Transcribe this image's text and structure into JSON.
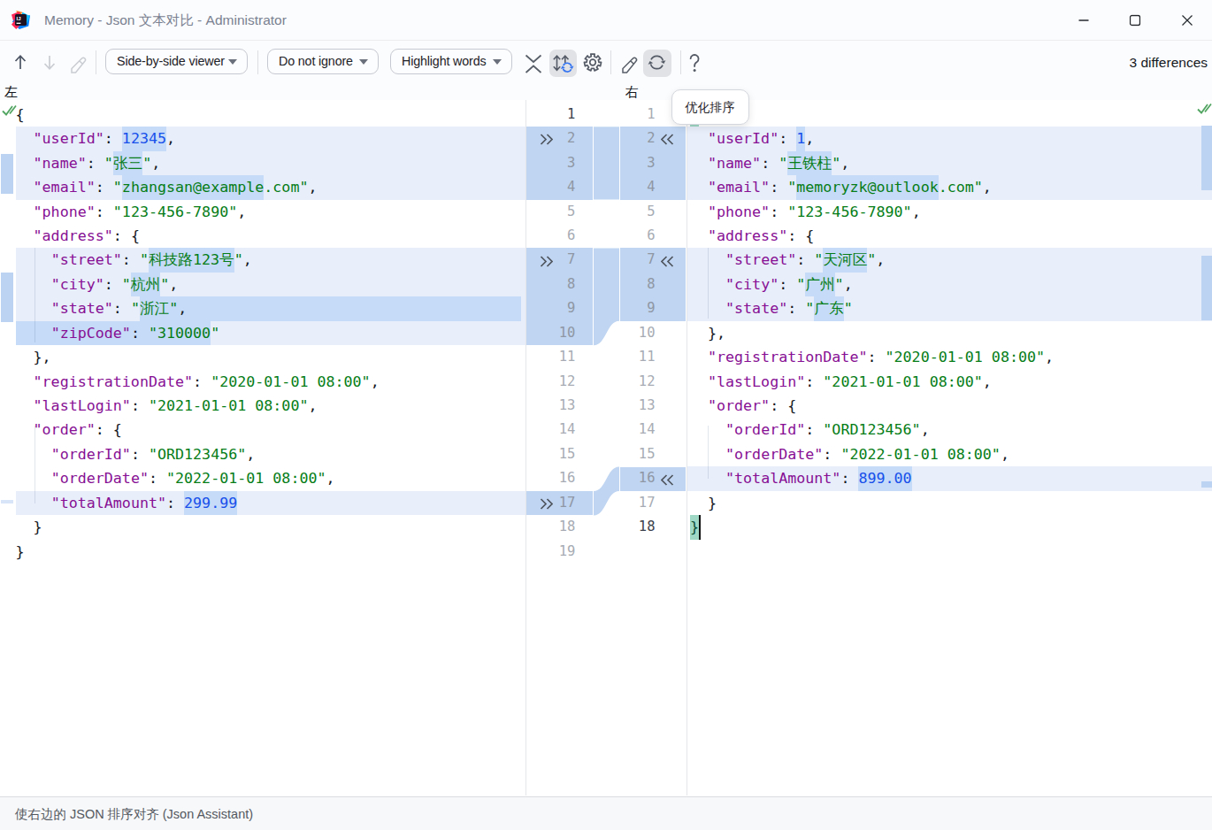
{
  "window": {
    "title": "Memory - Json 文本对比 - Administrator",
    "app_icon": "intellij-idea-logo"
  },
  "toolbar": {
    "viewer_dropdown": "Side-by-side viewer",
    "ignore_dropdown": "Do not ignore",
    "highlight_dropdown": "Highlight words",
    "differences_label": "3 differences",
    "icons": [
      "previous-difference",
      "next-difference",
      "edit",
      "collapse",
      "sort-align",
      "settings",
      "edit-source",
      "optimize-sort-refresh",
      "help"
    ]
  },
  "pane_headers": {
    "left": "左",
    "right": "右"
  },
  "tooltip": {
    "text": "优化排序"
  },
  "status_bar": {
    "text": "使右边的 JSON 排序对齐 (Json Assistant)"
  },
  "colors": {
    "changed_line_bg": "#e8effb",
    "word_diff_bg": "#c6dbf7",
    "gutter_block_bg": "#bfd5f1",
    "stripe_mark": "#bcd4f1",
    "key": "#871094",
    "string": "#067d17",
    "number": "#1750eb",
    "punctuation": "#15181e",
    "matched_brace_bg": "#9fd8c5",
    "accent_blue": "#3574f0",
    "icon_gray": "#5a616e",
    "check_green": "#51a561"
  },
  "diff_blocks": [
    {
      "left": [
        2,
        4
      ],
      "right": [
        2,
        4
      ]
    },
    {
      "left": [
        7,
        10
      ],
      "right": [
        7,
        9
      ]
    },
    {
      "left": [
        17,
        17
      ],
      "right": [
        16,
        16
      ]
    }
  ],
  "left_editor": {
    "line_count": 19,
    "line_numbers": [
      1,
      2,
      3,
      4,
      5,
      6,
      7,
      8,
      9,
      10,
      11,
      12,
      13,
      14,
      15,
      16,
      17,
      18,
      19
    ],
    "changed_lines": [
      2,
      3,
      4,
      7,
      8,
      9,
      10,
      17
    ],
    "current_line": 1,
    "lines": [
      {
        "n": 1,
        "segs": [
          [
            "p",
            "{"
          ]
        ]
      },
      {
        "n": 2,
        "segs": [
          [
            "p",
            "  "
          ],
          [
            "k",
            "\"userId\""
          ],
          [
            "p",
            ": "
          ],
          [
            "n",
            "12345",
            1
          ],
          [
            "p",
            ","
          ]
        ]
      },
      {
        "n": 3,
        "segs": [
          [
            "p",
            "  "
          ],
          [
            "k",
            "\"name\""
          ],
          [
            "p",
            ": "
          ],
          [
            "s",
            "\""
          ],
          [
            "s",
            "张三",
            1
          ],
          [
            "s",
            "\""
          ],
          [
            "p",
            ","
          ]
        ]
      },
      {
        "n": 4,
        "segs": [
          [
            "p",
            "  "
          ],
          [
            "k",
            "\"email\""
          ],
          [
            "p",
            ": "
          ],
          [
            "s",
            "\""
          ],
          [
            "s",
            "zhangsan@example",
            1
          ],
          [
            "s",
            ".com\""
          ],
          [
            "p",
            ","
          ]
        ]
      },
      {
        "n": 5,
        "segs": [
          [
            "p",
            "  "
          ],
          [
            "k",
            "\"phone\""
          ],
          [
            "p",
            ": "
          ],
          [
            "s",
            "\"123-456-7890\""
          ],
          [
            "p",
            ","
          ]
        ]
      },
      {
        "n": 6,
        "segs": [
          [
            "p",
            "  "
          ],
          [
            "k",
            "\"address\""
          ],
          [
            "p",
            ": "
          ],
          [
            "p",
            "{"
          ]
        ]
      },
      {
        "n": 7,
        "segs": [
          [
            "p",
            "    "
          ],
          [
            "k",
            "\"street\""
          ],
          [
            "p",
            ": "
          ],
          [
            "s",
            "\""
          ],
          [
            "s",
            "科技路123号",
            1
          ],
          [
            "s",
            "\""
          ],
          [
            "p",
            ","
          ]
        ]
      },
      {
        "n": 8,
        "segs": [
          [
            "p",
            "    "
          ],
          [
            "k",
            "\"city\""
          ],
          [
            "p",
            ": "
          ],
          [
            "s",
            "\""
          ],
          [
            "s",
            "杭州",
            1
          ],
          [
            "s",
            "\""
          ],
          [
            "p",
            ","
          ]
        ]
      },
      {
        "n": 9,
        "tail": 1,
        "segs": [
          [
            "p",
            "    "
          ],
          [
            "k",
            "\"state\""
          ],
          [
            "p",
            ": "
          ],
          [
            "s",
            "\""
          ],
          [
            "s",
            "浙江",
            1
          ],
          [
            "s",
            "\"",
            1
          ],
          [
            "p",
            ",",
            1
          ]
        ]
      },
      {
        "n": 10,
        "segs": [
          [
            "p",
            "    ",
            1
          ],
          [
            "k",
            "\"zipCode\"",
            1
          ],
          [
            "p",
            ": ",
            1
          ],
          [
            "s",
            "\"310000",
            1
          ],
          [
            "s",
            "\""
          ]
        ]
      },
      {
        "n": 11,
        "segs": [
          [
            "p",
            "  },"
          ]
        ]
      },
      {
        "n": 12,
        "segs": [
          [
            "p",
            "  "
          ],
          [
            "k",
            "\"registrationDate\""
          ],
          [
            "p",
            ": "
          ],
          [
            "s",
            "\"2020-01-01 08:00\""
          ],
          [
            "p",
            ","
          ]
        ]
      },
      {
        "n": 13,
        "segs": [
          [
            "p",
            "  "
          ],
          [
            "k",
            "\"lastLogin\""
          ],
          [
            "p",
            ": "
          ],
          [
            "s",
            "\"2021-01-01 08:00\""
          ],
          [
            "p",
            ","
          ]
        ]
      },
      {
        "n": 14,
        "segs": [
          [
            "p",
            "  "
          ],
          [
            "k",
            "\"order\""
          ],
          [
            "p",
            ": "
          ],
          [
            "p",
            "{"
          ]
        ]
      },
      {
        "n": 15,
        "segs": [
          [
            "p",
            "    "
          ],
          [
            "k",
            "\"orderId\""
          ],
          [
            "p",
            ": "
          ],
          [
            "s",
            "\"ORD123456\""
          ],
          [
            "p",
            ","
          ]
        ]
      },
      {
        "n": 16,
        "segs": [
          [
            "p",
            "    "
          ],
          [
            "k",
            "\"orderDate\""
          ],
          [
            "p",
            ": "
          ],
          [
            "s",
            "\"2022-01-01 08:00\""
          ],
          [
            "p",
            ","
          ]
        ]
      },
      {
        "n": 17,
        "segs": [
          [
            "p",
            "    "
          ],
          [
            "k",
            "\"totalAmount\""
          ],
          [
            "p",
            ": "
          ],
          [
            "n",
            "299.99",
            1
          ]
        ]
      },
      {
        "n": 18,
        "segs": [
          [
            "p",
            "  }"
          ]
        ]
      },
      {
        "n": 19,
        "segs": [
          [
            "p",
            "}"
          ]
        ]
      }
    ]
  },
  "right_editor": {
    "line_count": 18,
    "line_numbers": [
      1,
      2,
      3,
      4,
      5,
      6,
      7,
      8,
      9,
      10,
      11,
      12,
      13,
      14,
      15,
      16,
      17,
      18
    ],
    "changed_lines": [
      2,
      3,
      4,
      7,
      8,
      9,
      16
    ],
    "current_line": 18,
    "caret_line": 18,
    "matched_brace_lines": [
      1,
      18
    ],
    "lines": [
      {
        "n": 1,
        "segs": [
          [
            "p",
            "{",
            "b"
          ]
        ]
      },
      {
        "n": 2,
        "segs": [
          [
            "p",
            "  "
          ],
          [
            "k",
            "\"userId\""
          ],
          [
            "p",
            ": "
          ],
          [
            "n",
            "1",
            1
          ],
          [
            "p",
            ","
          ]
        ]
      },
      {
        "n": 3,
        "segs": [
          [
            "p",
            "  "
          ],
          [
            "k",
            "\"name\""
          ],
          [
            "p",
            ": "
          ],
          [
            "s",
            "\""
          ],
          [
            "s",
            "王铁柱",
            1
          ],
          [
            "s",
            "\""
          ],
          [
            "p",
            ","
          ]
        ]
      },
      {
        "n": 4,
        "segs": [
          [
            "p",
            "  "
          ],
          [
            "k",
            "\"email\""
          ],
          [
            "p",
            ": "
          ],
          [
            "s",
            "\""
          ],
          [
            "s",
            "memoryzk@outlook",
            1
          ],
          [
            "s",
            ".com\""
          ],
          [
            "p",
            ","
          ]
        ]
      },
      {
        "n": 5,
        "segs": [
          [
            "p",
            "  "
          ],
          [
            "k",
            "\"phone\""
          ],
          [
            "p",
            ": "
          ],
          [
            "s",
            "\"123-456-7890\""
          ],
          [
            "p",
            ","
          ]
        ]
      },
      {
        "n": 6,
        "segs": [
          [
            "p",
            "  "
          ],
          [
            "k",
            "\"address\""
          ],
          [
            "p",
            ": "
          ],
          [
            "p",
            "{"
          ]
        ]
      },
      {
        "n": 7,
        "segs": [
          [
            "p",
            "    "
          ],
          [
            "k",
            "\"street\""
          ],
          [
            "p",
            ": "
          ],
          [
            "s",
            "\""
          ],
          [
            "s",
            "天河区",
            1
          ],
          [
            "s",
            "\""
          ],
          [
            "p",
            ","
          ]
        ]
      },
      {
        "n": 8,
        "segs": [
          [
            "p",
            "    "
          ],
          [
            "k",
            "\"city\""
          ],
          [
            "p",
            ": "
          ],
          [
            "s",
            "\""
          ],
          [
            "s",
            "广州",
            1
          ],
          [
            "s",
            "\""
          ],
          [
            "p",
            ","
          ]
        ]
      },
      {
        "n": 9,
        "segs": [
          [
            "p",
            "    "
          ],
          [
            "k",
            "\"state\""
          ],
          [
            "p",
            ": "
          ],
          [
            "s",
            "\""
          ],
          [
            "s",
            "广东",
            1
          ],
          [
            "s",
            "\""
          ]
        ]
      },
      {
        "n": 10,
        "segs": [
          [
            "p",
            "  },"
          ]
        ]
      },
      {
        "n": 11,
        "segs": [
          [
            "p",
            "  "
          ],
          [
            "k",
            "\"registrationDate\""
          ],
          [
            "p",
            ": "
          ],
          [
            "s",
            "\"2020-01-01 08:00\""
          ],
          [
            "p",
            ","
          ]
        ]
      },
      {
        "n": 12,
        "segs": [
          [
            "p",
            "  "
          ],
          [
            "k",
            "\"lastLogin\""
          ],
          [
            "p",
            ": "
          ],
          [
            "s",
            "\"2021-01-01 08:00\""
          ],
          [
            "p",
            ","
          ]
        ]
      },
      {
        "n": 13,
        "segs": [
          [
            "p",
            "  "
          ],
          [
            "k",
            "\"order\""
          ],
          [
            "p",
            ": "
          ],
          [
            "p",
            "{"
          ]
        ]
      },
      {
        "n": 14,
        "segs": [
          [
            "p",
            "    "
          ],
          [
            "k",
            "\"orderId\""
          ],
          [
            "p",
            ": "
          ],
          [
            "s",
            "\"ORD123456\""
          ],
          [
            "p",
            ","
          ]
        ]
      },
      {
        "n": 15,
        "segs": [
          [
            "p",
            "    "
          ],
          [
            "k",
            "\"orderDate\""
          ],
          [
            "p",
            ": "
          ],
          [
            "s",
            "\"2022-01-01 08:00\""
          ],
          [
            "p",
            ","
          ]
        ]
      },
      {
        "n": 16,
        "segs": [
          [
            "p",
            "    "
          ],
          [
            "k",
            "\"totalAmount\""
          ],
          [
            "p",
            ": "
          ],
          [
            "n",
            "899.00",
            1
          ]
        ]
      },
      {
        "n": 17,
        "segs": [
          [
            "p",
            "  }"
          ]
        ]
      },
      {
        "n": 18,
        "caret": 1,
        "segs": [
          [
            "p",
            "}",
            "b"
          ]
        ]
      }
    ]
  }
}
